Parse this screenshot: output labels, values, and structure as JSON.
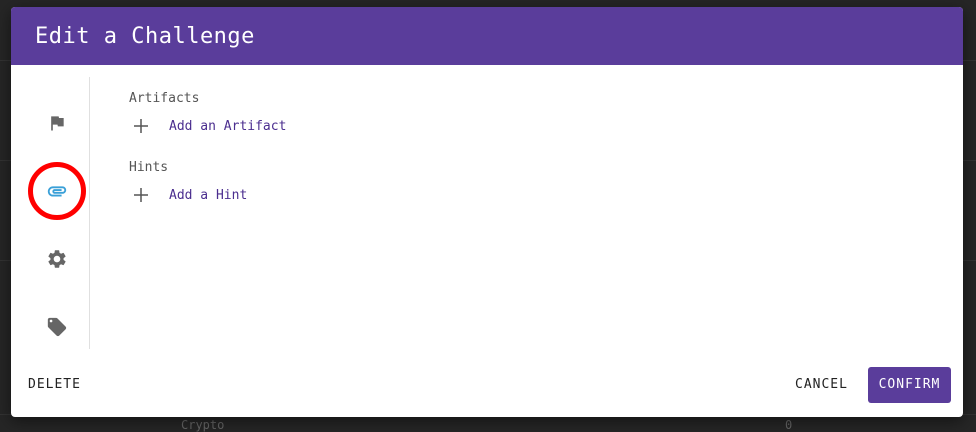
{
  "dialog": {
    "title": "Edit a Challenge"
  },
  "side_nav": {
    "items": [
      {
        "icon": "flag-icon",
        "active": false
      },
      {
        "icon": "paperclip-icon",
        "active": true
      },
      {
        "icon": "gear-icon",
        "active": false
      },
      {
        "icon": "tag-icon",
        "active": false
      }
    ]
  },
  "sections": {
    "artifacts": {
      "title": "Artifacts",
      "add_label": "Add an Artifact"
    },
    "hints": {
      "title": "Hints",
      "add_label": "Add a Hint"
    }
  },
  "footer": {
    "delete_label": "DELETE",
    "cancel_label": "CANCEL",
    "confirm_label": "CONFIRM"
  },
  "background": {
    "row_label": "Crypto",
    "row_value": "0"
  },
  "colors": {
    "accent": "#5a3d9b",
    "highlight": "#ff0000",
    "active_icon": "#3aa0d8",
    "inactive_icon": "#666666"
  }
}
